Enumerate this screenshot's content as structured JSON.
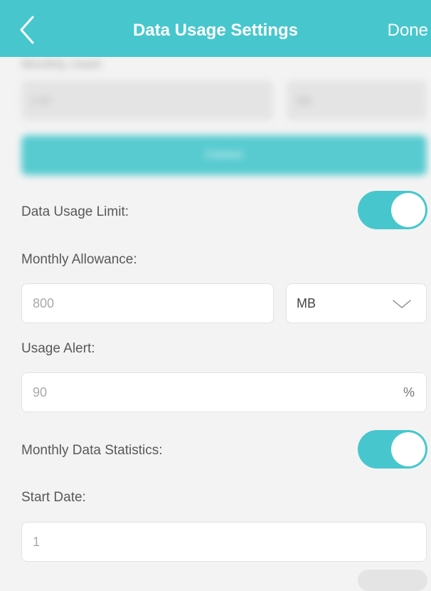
{
  "header": {
    "title": "Data Usage Settings",
    "done_label": "Done",
    "back_icon": "chevron-left-icon"
  },
  "blurred_section": {
    "label": "Monthly Used:",
    "used_value": "3.00",
    "unit": "MB",
    "button_label": "Correct"
  },
  "data_usage_limit": {
    "label": "Data Usage Limit:",
    "enabled": true
  },
  "monthly_allowance": {
    "label": "Monthly Allowance:",
    "value": "800",
    "unit": "MB",
    "unit_icon": "chevron-down-icon"
  },
  "usage_alert": {
    "label": "Usage Alert:",
    "value": "90",
    "suffix": "%"
  },
  "monthly_data_statistics": {
    "label": "Monthly Data Statistics:",
    "enabled": true
  },
  "start_date": {
    "label": "Start Date:",
    "value": "1"
  },
  "colors": {
    "accent": "#47c7cd",
    "background": "#f3f3f3",
    "field_background": "#ffffff"
  }
}
